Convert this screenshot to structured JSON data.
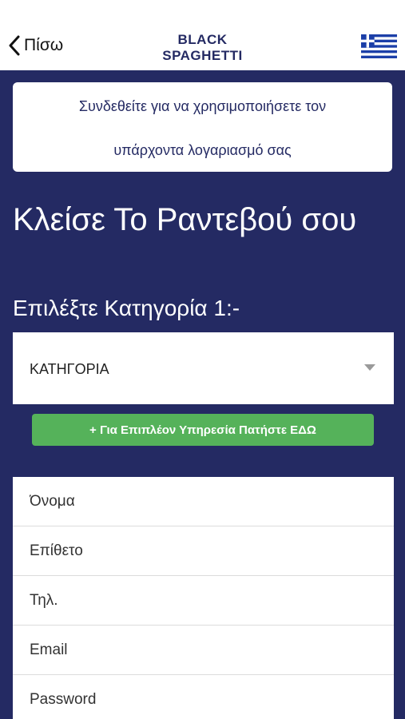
{
  "header": {
    "back_label": "Πίσω",
    "brand_line1": "BLACK",
    "brand_line2": "SPAGHETTI",
    "language_flag": "greece-flag-icon"
  },
  "notice": {
    "line1": "Συνδεθείτε για να χρησιμοποιήσετε τον",
    "line2": "υπάρχοντα λογαριασμό σας"
  },
  "booking": {
    "title": "Κλείσε Το Ραντεβού σου",
    "subtitle": "Επιλέξτε Κατηγορία 1:-",
    "category_selected": "ΚΑΤΗΓΟΡΙΑ",
    "add_service_button": "+ Για Επιπλέον Υπηρεσία Πατήστε ΕΔΩ"
  },
  "form": {
    "first_name_placeholder": "Όνομα",
    "last_name_placeholder": "Επίθετο",
    "phone_placeholder": "Τηλ.",
    "email_placeholder": "Email",
    "password_placeholder": "Password"
  },
  "colors": {
    "primary": "#242a63",
    "accent_green": "#55b25a",
    "flag_blue": "#1c3fa8"
  }
}
